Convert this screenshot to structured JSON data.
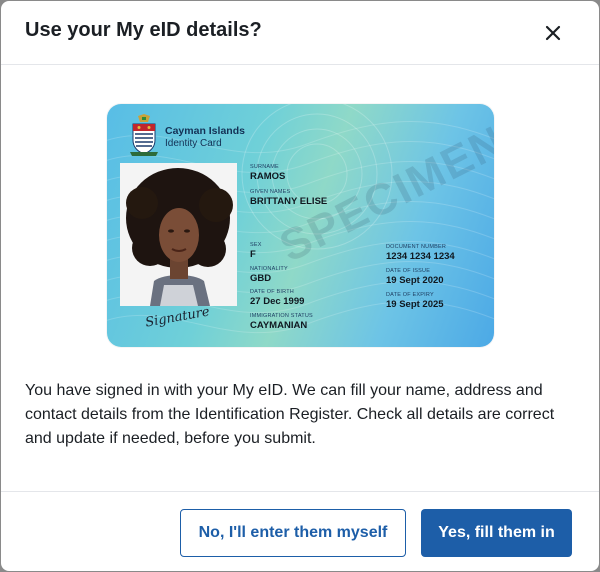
{
  "dialog": {
    "title": "Use your My eID details?",
    "close_icon": "close-icon",
    "message": "You have signed in with your My eID. We can fill your name, address and contact details from the Identification Register. Check all details are correct and update if needed, before you submit."
  },
  "card": {
    "issuer": "Cayman Islands",
    "issuer_sub": "Identity Card",
    "watermark": "SPECIMEN",
    "signature": "Signature",
    "fields": {
      "surname_label": "Surname",
      "surname": "RAMOS",
      "given_names_label": "Given names",
      "given_names": "BRITTANY ELISE",
      "sex_label": "Sex",
      "sex": "F",
      "nationality_label": "Nationality",
      "nationality": "GBD",
      "dob_label": "Date of birth",
      "dob": "27 Dec 1999",
      "immigration_label": "Immigration status",
      "immigration": "CAYMANIAN",
      "doc_number_label": "Document number",
      "doc_number": "1234 1234 1234",
      "issue_label": "Date of issue",
      "issue": "19 Sept 2020",
      "expiry_label": "Date of expiry",
      "expiry": "19 Sept 2025"
    }
  },
  "actions": {
    "secondary_label": "No, I'll enter them myself",
    "primary_label": "Yes, fill them in"
  },
  "colors": {
    "primary": "#1d5ea8",
    "text": "#1b1f24",
    "divider": "#e4e6ea"
  }
}
